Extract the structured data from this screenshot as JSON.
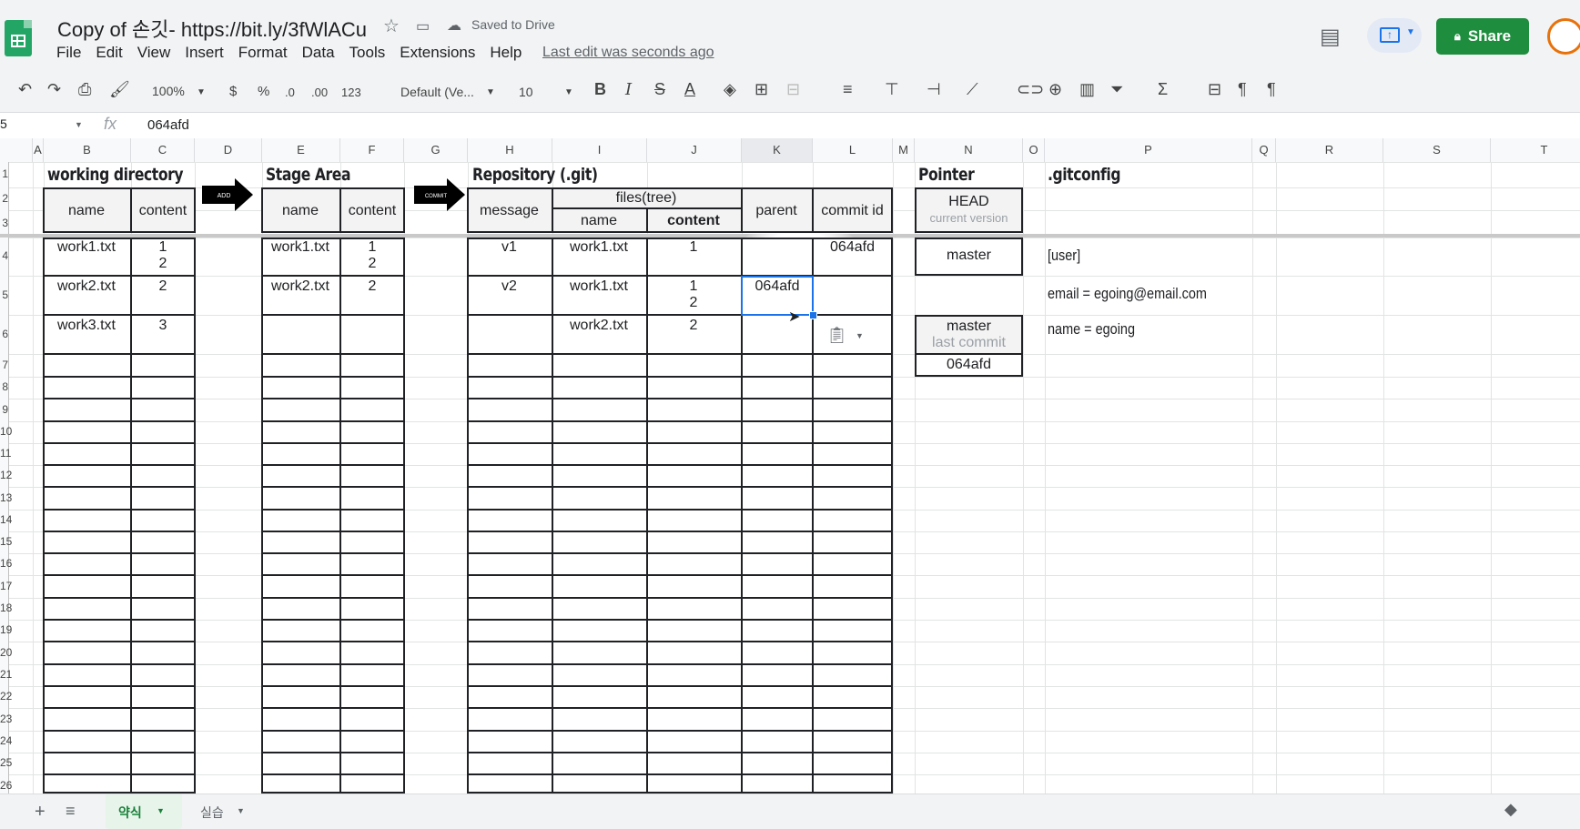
{
  "titlebar": {
    "title": "Copy of 손깃- https://bit.ly/3fWlACu",
    "saved": "Saved to Drive",
    "menu": [
      "File",
      "Edit",
      "View",
      "Insert",
      "Format",
      "Data",
      "Tools",
      "Extensions",
      "Help"
    ],
    "last_edit": "Last edit was seconds ago",
    "share_label": "Share"
  },
  "toolbar": {
    "zoom": "100%",
    "currency": "$",
    "percent": "%",
    "dec_dec": ".0",
    "dec_inc": ".00",
    "format_more": "123",
    "font": "Default (Ve...",
    "font_size": "10",
    "bold": "B",
    "italic": "I",
    "strike": "S",
    "textcolor": "A"
  },
  "formula_bar": {
    "cell": "5",
    "fx": "fx",
    "value": "064afd"
  },
  "columns": [
    "A",
    "B",
    "C",
    "D",
    "E",
    "F",
    "G",
    "H",
    "I",
    "J",
    "K",
    "L",
    "M",
    "N",
    "O",
    "P",
    "Q",
    "R",
    "S",
    "T"
  ],
  "rows": [
    "1",
    "2",
    "3",
    "4",
    "5",
    "6",
    "7",
    "8",
    "9",
    "10",
    "11",
    "12",
    "13",
    "14",
    "15",
    "16",
    "17",
    "18",
    "19",
    "20",
    "21",
    "22",
    "23",
    "24",
    "25",
    "26"
  ],
  "sections": {
    "wd": "working directory",
    "stage": "Stage Area",
    "repo": "Repository (.git)",
    "pointer": "Pointer",
    "gitconfig": ".gitconfig",
    "add": "ADD",
    "commit": "COMMIT"
  },
  "headers": {
    "name": "name",
    "content": "content",
    "message": "message",
    "files_tree": "files(tree)",
    "parent": "parent",
    "commit_id": "commit id",
    "head": "HEAD",
    "current_version": "current version"
  },
  "wd_rows": [
    {
      "name": "work1.txt",
      "content": "1\n2"
    },
    {
      "name": "work2.txt",
      "content": "2"
    },
    {
      "name": "work3.txt",
      "content": "3"
    }
  ],
  "stage_rows": [
    {
      "name": "work1.txt",
      "content": "1\n2"
    },
    {
      "name": "work2.txt",
      "content": "2"
    }
  ],
  "repo": {
    "r1": {
      "message": "v1",
      "name": "work1.txt",
      "content": "1",
      "commit_id": "064afd"
    },
    "r2": {
      "message": "v2",
      "name": "work1.txt",
      "content": "1\n2",
      "parent": "064afd"
    },
    "r3": {
      "name": "work2.txt",
      "content": "2"
    }
  },
  "pointer": {
    "head_target": "master",
    "master": "master",
    "last_commit": "last commit",
    "master_id": "064afd"
  },
  "gitconfig": {
    "section": "[user]",
    "email": "email = egoing@email.com",
    "name": "name = egoing"
  },
  "tabs": [
    "약식",
    "실습"
  ]
}
